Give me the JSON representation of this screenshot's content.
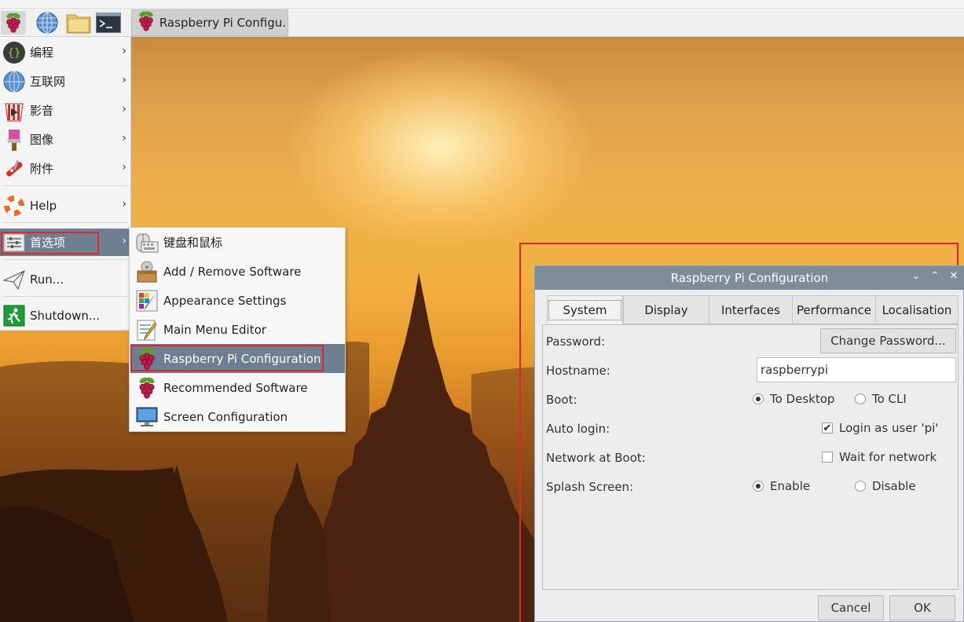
{
  "taskbar": {
    "task_title": "Raspberry Pi Configu…",
    "icons": [
      "raspberry-menu-icon",
      "web-browser-icon",
      "file-manager-icon",
      "terminal-icon"
    ]
  },
  "main_menu": {
    "items": [
      {
        "label": "编程",
        "icon": "programming-icon"
      },
      {
        "label": "互联网",
        "icon": "internet-icon"
      },
      {
        "label": "影音",
        "icon": "sound-video-icon"
      },
      {
        "label": "图像",
        "icon": "graphics-icon"
      },
      {
        "label": "附件",
        "icon": "accessories-icon"
      },
      {
        "label": "Help",
        "icon": "help-lifebuoy-icon"
      },
      {
        "label": "首选项",
        "icon": "preferences-icon"
      },
      {
        "label": "Run...",
        "icon": "run-paperplane-icon"
      },
      {
        "label": "Shutdown...",
        "icon": "shutdown-exit-icon"
      }
    ],
    "arrow": "›"
  },
  "sub_menu": {
    "items": [
      {
        "label": "键盘和鼠标",
        "icon": "keyboard-mouse-icon"
      },
      {
        "label": "Add / Remove Software",
        "icon": "package-icon"
      },
      {
        "label": "Appearance Settings",
        "icon": "appearance-icon"
      },
      {
        "label": "Main Menu Editor",
        "icon": "menu-editor-icon"
      },
      {
        "label": "Raspberry Pi Configuration",
        "icon": "raspberry-icon"
      },
      {
        "label": "Recommended Software",
        "icon": "raspberry-icon"
      },
      {
        "label": "Screen Configuration",
        "icon": "monitor-icon"
      }
    ]
  },
  "dialog": {
    "title": "Raspberry Pi Configuration",
    "controls": {
      "minimize": "⌄",
      "maximize": "⌃",
      "close": "✕"
    },
    "tabs": [
      "System",
      "Display",
      "Interfaces",
      "Performance",
      "Localisation"
    ],
    "rows": {
      "password": {
        "label": "Password:",
        "button": "Change Password..."
      },
      "hostname": {
        "label": "Hostname:",
        "value": "raspberrypi"
      },
      "boot": {
        "label": "Boot:",
        "opt1": "To Desktop",
        "opt2": "To CLI"
      },
      "autologin": {
        "label": "Auto login:",
        "check": "Login as user 'pi'"
      },
      "network": {
        "label": "Network at Boot:",
        "check": "Wait for network"
      },
      "splash": {
        "label": "Splash Screen:",
        "opt1": "Enable",
        "opt2": "Disable"
      }
    },
    "buttons": {
      "cancel": "Cancel",
      "ok": "OK"
    }
  }
}
